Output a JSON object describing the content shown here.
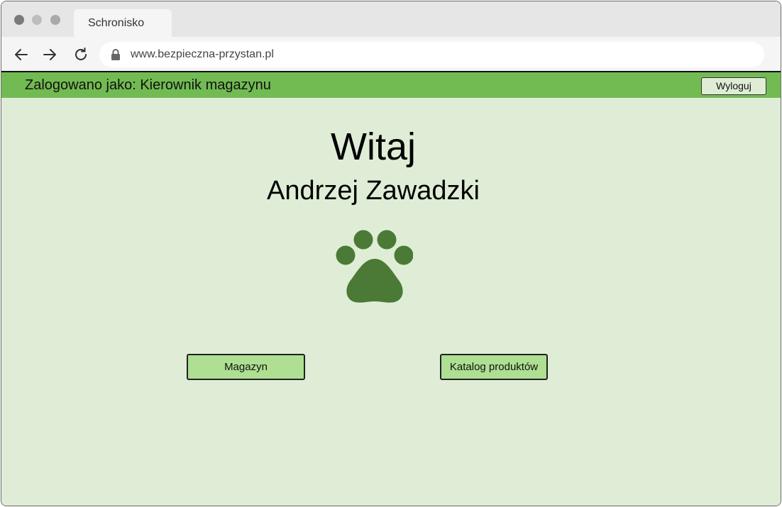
{
  "browser": {
    "tab_title": "Schronisko",
    "url": "www.bezpieczna-przystan.pl"
  },
  "header": {
    "logged_in_text": "Zalogowano jako: Kierownik magazynu",
    "logout_label": "Wyloguj",
    "background_color": "#72bb53"
  },
  "main": {
    "welcome": "Witaj",
    "user_name": "Andrzej Zawadzki",
    "logo_icon": "paw-icon",
    "logo_color": "#4a7a35",
    "buttons": {
      "warehouse": "Magazyn",
      "catalog": "Katalog produktów"
    },
    "button_color": "#aedf92",
    "background_color": "#dfedd6"
  }
}
